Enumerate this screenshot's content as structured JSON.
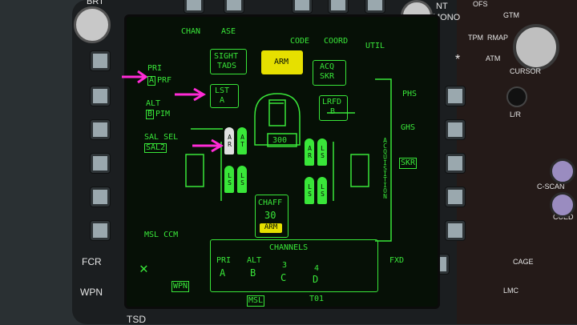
{
  "top_labels": [
    "CHAN",
    "ASE",
    "CODE",
    "COORD",
    "UTIL"
  ],
  "top_left": "BRT",
  "top_right": [
    "NT",
    "MONO"
  ],
  "right_panel": {
    "labels": [
      "OFS",
      "GTM",
      "RMAP",
      "ATM",
      "TPM",
      "CURSOR",
      "L/R",
      "C-SCAN",
      "CUED",
      "CAGE",
      "LMC"
    ]
  },
  "left_bezel": [
    "FCR",
    "WPN",
    "TSD"
  ],
  "left_screen": {
    "pri_label": "PRI",
    "pri_code": "A",
    "pri_mode": "PRF",
    "alt_label": "ALT",
    "alt_code": "B",
    "alt_mode": "PIM",
    "sal_sel": "SAL SEL",
    "sal_value": "SAL2",
    "msl_ccm": "MSL CCM"
  },
  "center": {
    "sight": "SIGHT",
    "tads": "TADS",
    "arm": "ARM",
    "acq": "ACQ",
    "skr": "SKR",
    "lst": "LST",
    "lst_code": "A",
    "lrfd": "LRFD",
    "lrfd_code": "B",
    "gun_rounds": "300",
    "chaff_label": "CHAFF",
    "chaff_count": "30",
    "chaff_arm": "ARM"
  },
  "missiles": {
    "left_top": [
      "AR",
      "AT"
    ],
    "left_bottom": [
      "LS",
      "LS"
    ],
    "right_top": [
      "AR",
      "LS"
    ],
    "right_bottom": [
      "LS",
      "LS"
    ]
  },
  "right_screen": {
    "phs": "PHS",
    "ghs": "GHS",
    "skr": "SKR",
    "acquisition": "ACQUISITION",
    "fxd": "FXD"
  },
  "channels": {
    "title": "CHANNELS",
    "items": [
      {
        "label": "PRI",
        "value": "A"
      },
      {
        "label": "ALT",
        "value": "B"
      },
      {
        "label": "3",
        "value": "C"
      },
      {
        "label": "4",
        "value": "D"
      }
    ]
  },
  "bottom": {
    "wpn": "WPN",
    "msl": "MSL",
    "t01": "T01"
  },
  "colors": {
    "symbology": "#39e639",
    "arm_yellow": "#e6e000",
    "callout_arrow": "#ff2bd6"
  }
}
